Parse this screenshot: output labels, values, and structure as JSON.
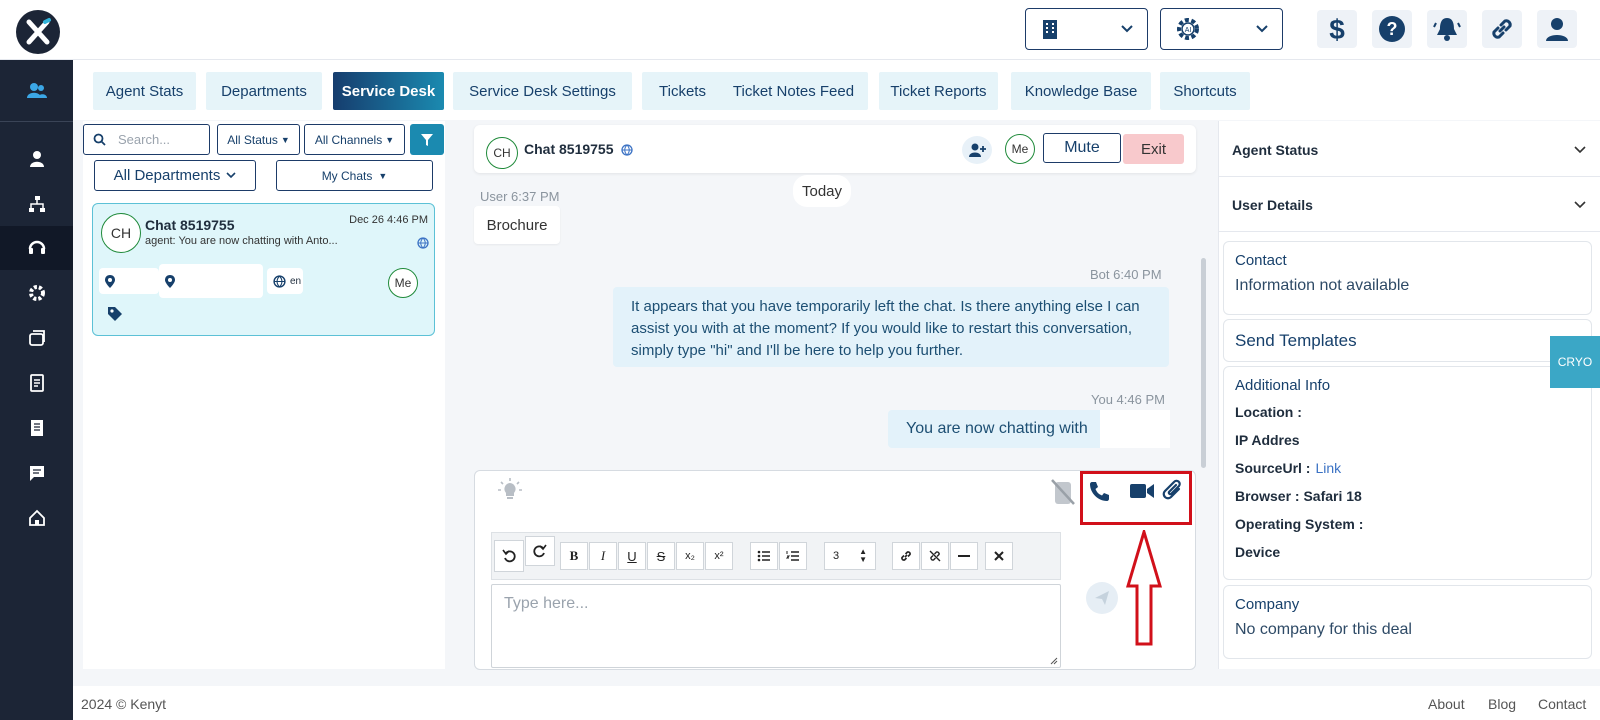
{
  "top_nav": {
    "icons": [
      "building-icon",
      "ai-gear-icon",
      "dollar-icon",
      "help-icon",
      "bell-icon",
      "link-icon",
      "user-icon"
    ]
  },
  "tabs": [
    {
      "label": "Agent Stats"
    },
    {
      "label": "Departments"
    },
    {
      "label": "Service Desk",
      "active": true
    },
    {
      "label": "Service Desk Settings"
    },
    {
      "label": "Tickets"
    },
    {
      "label": "Ticket Notes Feed"
    },
    {
      "label": "Ticket Reports"
    },
    {
      "label": "Knowledge Base"
    },
    {
      "label": "Shortcuts"
    }
  ],
  "filters": {
    "search_placeholder": "Search...",
    "status": "All Status",
    "channels": "All Channels",
    "departments": "All Departments",
    "my_chats": "My Chats"
  },
  "chat_list": [
    {
      "avatar": "CH",
      "title": "Chat 8519755",
      "date": "Dec 26 4:46 PM",
      "preview": "agent: You are now chatting with Anto...",
      "lang": "en",
      "agent": "Me"
    }
  ],
  "chat_header": {
    "avatar": "CH",
    "title": "Chat 8519755",
    "agent": "Me",
    "mute_label": "Mute",
    "exit_label": "Exit"
  },
  "messages": {
    "day_label": "Today",
    "user_meta": "User 6:37 PM",
    "user_text": "Brochure",
    "bot_meta": "Bot  6:40 PM",
    "bot_text": "It appears that you have temporarily left the chat. Is there anything else I can assist you with at the moment? If you would like to restart this conversation, simply type \"hi\" and I'll be here to help you further.",
    "you_meta": "You  4:46 PM",
    "you_text": "You are now chatting with"
  },
  "composer": {
    "placeholder": "Type here...",
    "font_size_value": "3"
  },
  "right_panel": {
    "agent_status": "Agent Status",
    "user_details": "User Details",
    "contact_title": "Contact",
    "contact_text": "Information not available",
    "send_templates": "Send Templates",
    "additional_title": "Additional Info",
    "location": "Location :",
    "ip": "IP Addres",
    "source_label": "SourceUrl :",
    "source_link": "Link",
    "browser": "Browser : Safari 18",
    "os": "Operating System :",
    "device": "Device",
    "company_title": "Company",
    "company_text": "No company for this deal",
    "side_tab": "CRYO"
  },
  "footer": {
    "copyright": "2024 © Kenyt",
    "links": [
      "About",
      "Blog",
      "Contact"
    ]
  },
  "colors": {
    "sidebar": "#1c2536",
    "accent": "#1b8ab0",
    "highlight": "#d1101a"
  }
}
